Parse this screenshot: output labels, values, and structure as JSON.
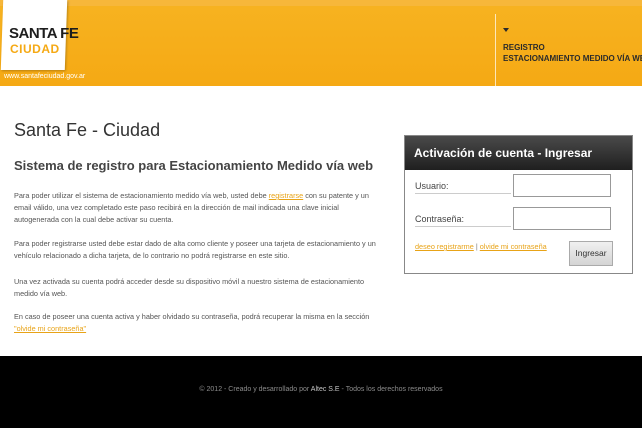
{
  "header": {
    "logo_title": "SANTA FE",
    "logo_sub": "CIUDAD",
    "site_url": "www.santafeciudad.gov.ar",
    "registry_line1": "REGISTRO",
    "registry_line2": "ESTACIONAMIENTO MEDIDO VÍA WEB"
  },
  "main": {
    "title": "Santa Fe - Ciudad",
    "subtitle": "Sistema de registro para Estacionamiento Medido vía web",
    "p1_before": "Para poder utilizar el sistema de estacionamiento medido vía web, usted debe ",
    "p1_link": "registrarse",
    "p1_after": " con su patente y un email válido, una vez completado este paso recibirá en la dirección de mail indicada una clave inicial autogenerada con la cual debe activar su cuenta.",
    "p2": "Para poder registrarse usted debe estar dado de alta como cliente y poseer una tarjeta de estacionamiento y un vehículo relacionado a dicha tarjeta, de lo contrario no podrá registrarse en este sitio.",
    "p3": "Una vez activada su cuenta podrá acceder desde su dispositivo móvil a nuestro sistema de estacionamiento medido vía web.",
    "p4_before": "En caso de poseer una cuenta activa y haber olvidado su contraseña, podrá recuperar la misma en la sección ",
    "p4_link": "\"olvide mi contraseña\""
  },
  "login": {
    "heading": "Activación de cuenta - Ingresar",
    "user_label": "Usuario:",
    "user_value": "",
    "pass_label": "Contraseña:",
    "pass_value": "",
    "link_register": "deseo registrarme",
    "separator": " | ",
    "link_forgot": "olvide mi contraseña",
    "submit_label": "Ingresar"
  },
  "footer": {
    "text_before": "© 2012 - Creado y desarrollado por ",
    "company": "Altec S.E",
    "text_after": " - Todos los derechos reservados"
  },
  "colors": {
    "brand_yellow": "#f5a914",
    "link_orange": "#e8a317",
    "footer_bg": "#000000"
  }
}
